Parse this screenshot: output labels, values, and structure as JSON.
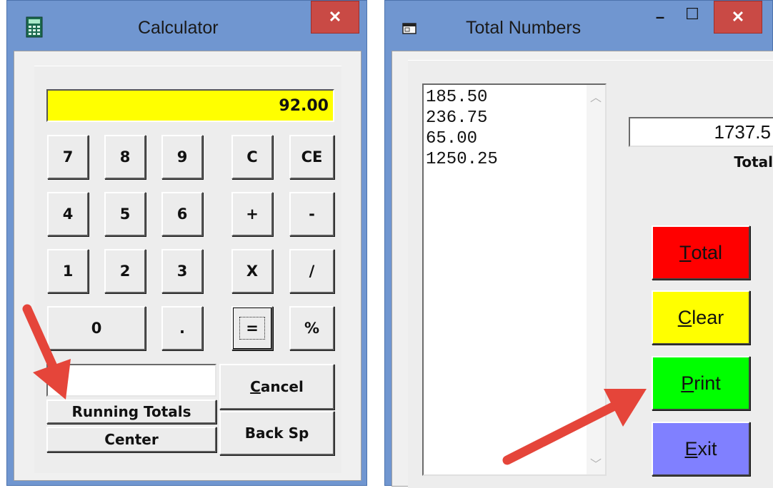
{
  "calculator": {
    "title": "Calculator",
    "app_icon": "calculator-icon",
    "close_label": "✕",
    "display": "92.00",
    "keys": {
      "k7": "7",
      "k8": "8",
      "k9": "9",
      "clear": "C",
      "clear_entry": "CE",
      "k4": "4",
      "k5": "5",
      "k6": "6",
      "plus": "+",
      "minus": "-",
      "k1": "1",
      "k2": "2",
      "k3": "3",
      "multiply": "X",
      "divide": "/",
      "k0": "0",
      "decimal": ".",
      "equals": "=",
      "percent": "%"
    },
    "running_totals_value": "",
    "running_totals_label": "Running Totals",
    "center_label": "Center",
    "cancel_label_u": "C",
    "cancel_label_rest": "ancel",
    "backspace_label": "Back Sp"
  },
  "total_numbers": {
    "title": "Total Numbers",
    "app_icon": "window-icon",
    "minimize_label": "–",
    "maximize_label": "☐",
    "close_label": "✕",
    "list_items": [
      "185.50",
      "236.75",
      "65.00",
      "1250.25"
    ],
    "total_value": "1737.5",
    "total_label": "Total",
    "buttons": {
      "total": {
        "u": "T",
        "rest": "otal",
        "color": "#ff0000"
      },
      "clear": {
        "u": "C",
        "rest": "lear",
        "color": "#ffff00"
      },
      "print": {
        "u": "P",
        "rest": "rint",
        "color": "#00ff00"
      },
      "exit": {
        "u": "E",
        "rest": "xit",
        "color": "#8080ff"
      }
    }
  },
  "annotations": {
    "arrow_color": "#e5453a"
  }
}
